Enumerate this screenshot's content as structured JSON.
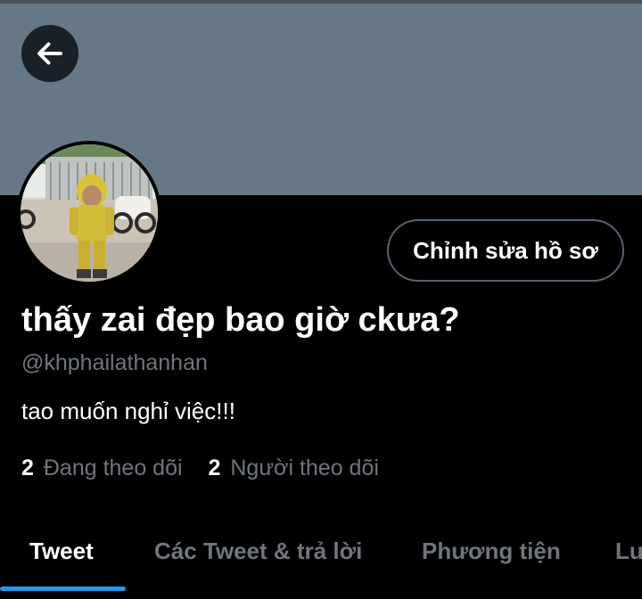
{
  "header": {
    "back_icon": "arrow-left-icon",
    "banner_color": "#667786"
  },
  "profile": {
    "avatar_icon": "profile-photo",
    "edit_button_label": "Chỉnh sửa hồ sơ",
    "display_name": "thấy zai đẹp bao giờ ckưa?",
    "handle": "@khphailathanhan",
    "bio": "tao muốn nghỉ việc!!!",
    "following_count": "2",
    "following_label": "Đang theo dõi",
    "followers_count": "2",
    "followers_label": "Người theo dõi"
  },
  "tabs": [
    {
      "label": "Tweet",
      "active": true
    },
    {
      "label": "Các Tweet & trả lời",
      "active": false
    },
    {
      "label": "Phương tiện",
      "active": false
    },
    {
      "label": "Lư",
      "active": false
    }
  ],
  "colors": {
    "background": "#000000",
    "accent": "#1d9bf0",
    "secondary_text": "#6e767d"
  }
}
